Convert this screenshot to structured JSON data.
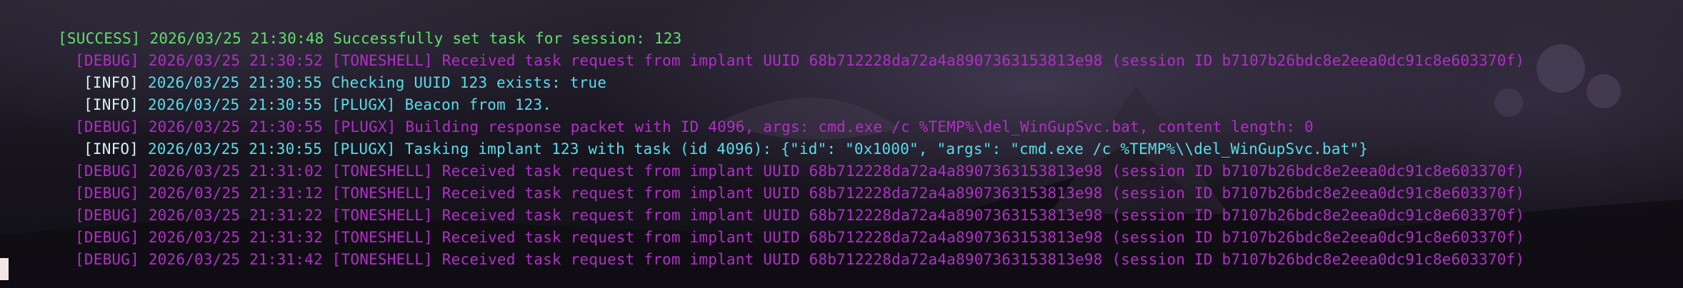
{
  "terminal": {
    "partial_top_line": "",
    "lines": [
      {
        "level": "[SUCCESS]",
        "text": "2026/03/25 21:30:48 Successfully set task for session: 123"
      },
      {
        "level": "[DEBUG]",
        "text": "2026/03/25 21:30:52 [TONESHELL] Received task request from implant UUID 68b712228da72a4a8907363153813e98 (session ID b7107b26bdc8e2eea0dc91c8e603370f)"
      },
      {
        "level": "[INFO]",
        "text": "2026/03/25 21:30:55 Checking UUID 123 exists: true"
      },
      {
        "level": "[INFO]",
        "text": "2026/03/25 21:30:55 [PLUGX] Beacon from 123."
      },
      {
        "level": "[DEBUG]",
        "text": "2026/03/25 21:30:55 [PLUGX] Building response packet with ID 4096, args: cmd.exe /c %TEMP%\\del_WinGupSvc.bat, content length: 0"
      },
      {
        "level": "[INFO]",
        "text": "2026/03/25 21:30:55 [PLUGX] Tasking implant 123 with task (id 4096): {\"id\": \"0x1000\", \"args\": \"cmd.exe /c %TEMP%\\\\del_WinGupSvc.bat\"}"
      },
      {
        "level": "[DEBUG]",
        "text": "2026/03/25 21:31:02 [TONESHELL] Received task request from implant UUID 68b712228da72a4a8907363153813e98 (session ID b7107b26bdc8e2eea0dc91c8e603370f)"
      },
      {
        "level": "[DEBUG]",
        "text": "2026/03/25 21:31:12 [TONESHELL] Received task request from implant UUID 68b712228da72a4a8907363153813e98 (session ID b7107b26bdc8e2eea0dc91c8e603370f)"
      },
      {
        "level": "[DEBUG]",
        "text": "2026/03/25 21:31:22 [TONESHELL] Received task request from implant UUID 68b712228da72a4a8907363153813e98 (session ID b7107b26bdc8e2eea0dc91c8e603370f)"
      },
      {
        "level": "[DEBUG]",
        "text": "2026/03/25 21:31:32 [TONESHELL] Received task request from implant UUID 68b712228da72a4a8907363153813e98 (session ID b7107b26bdc8e2eea0dc91c8e603370f)"
      },
      {
        "level": "[DEBUG]",
        "text": "2026/03/25 21:31:42 [TONESHELL] Received task request from implant UUID 68b712228da72a4a8907363153813e98 (session ID b7107b26bdc8e2eea0dc91c8e603370f)"
      }
    ]
  },
  "colors": {
    "success": "#5ee06b",
    "debug": "#b12fc7",
    "info_level": "#d8f4f8",
    "info_text": "#58dde8",
    "cursor": "#f3e6e6"
  },
  "icons": {
    "cursor": "terminal-cursor-block"
  }
}
